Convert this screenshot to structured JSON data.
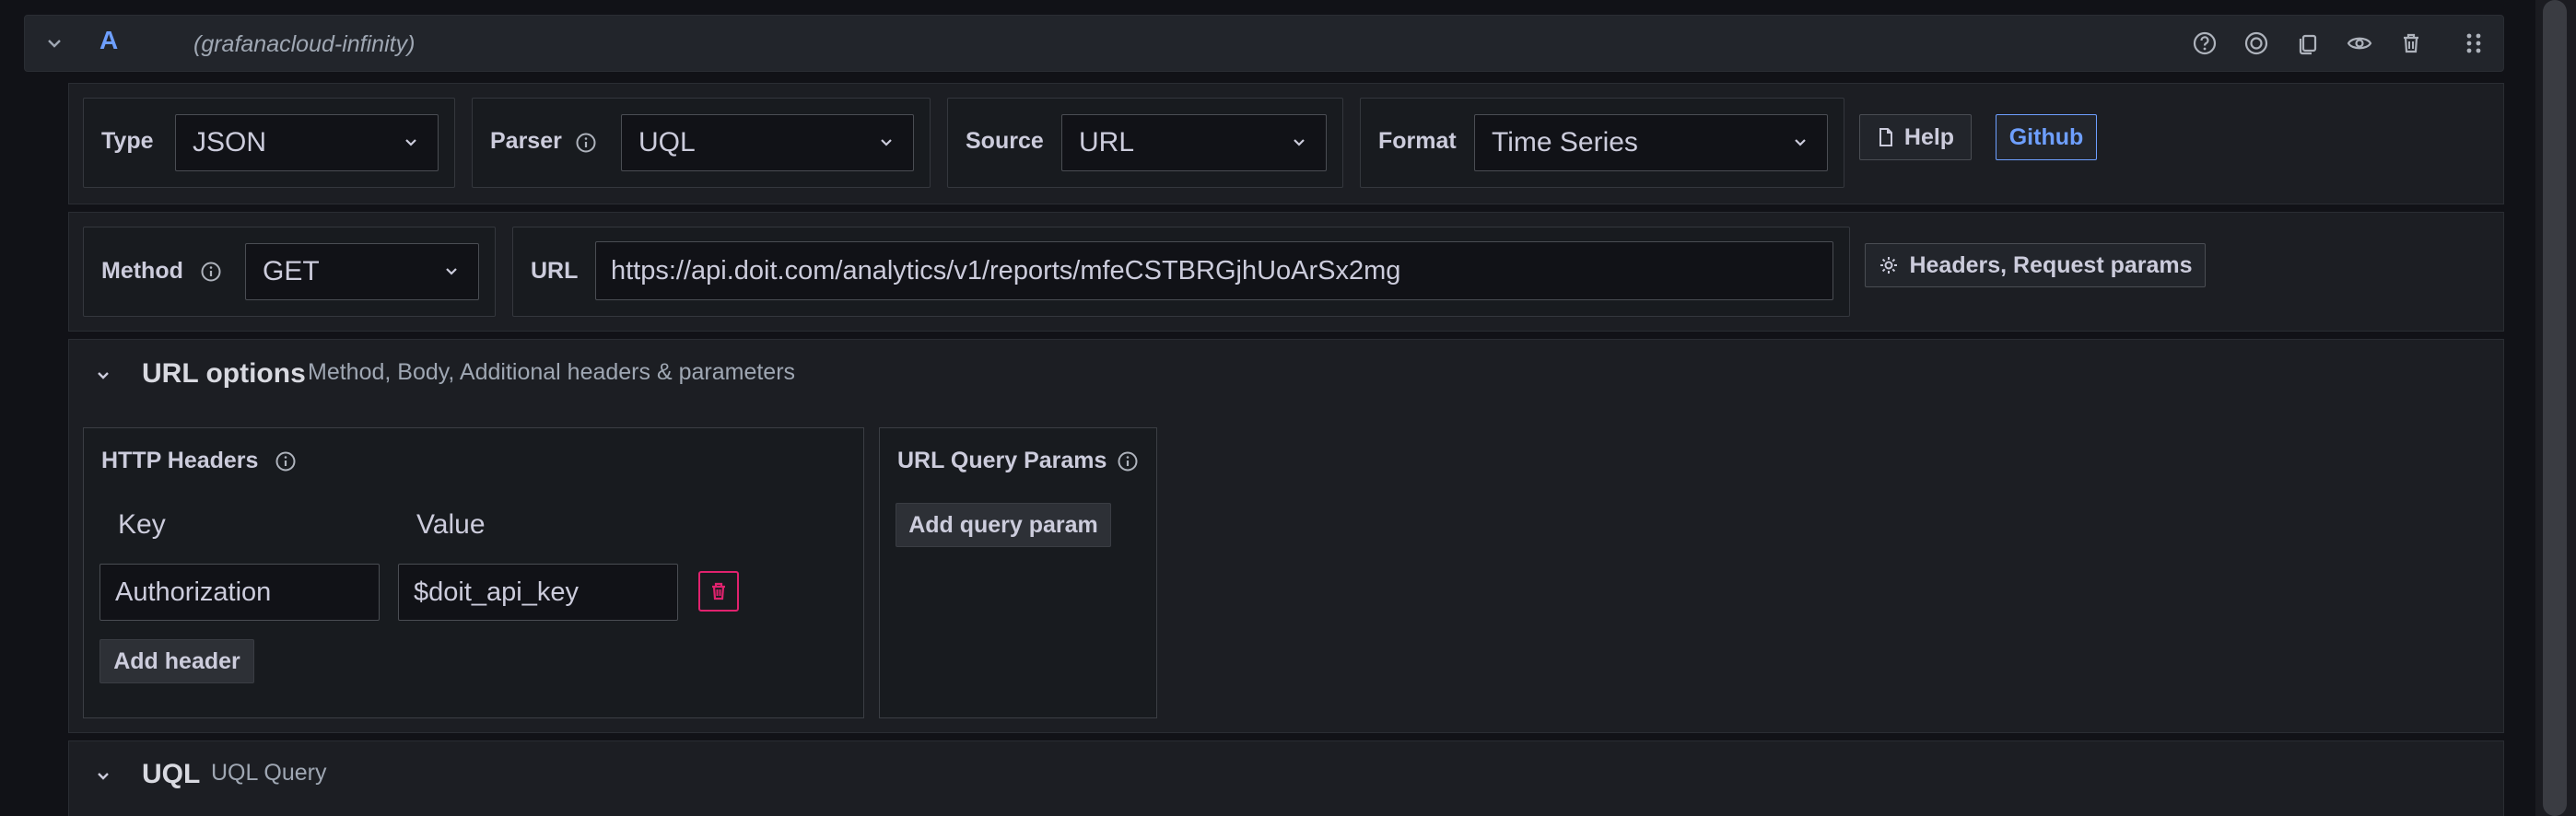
{
  "query": {
    "ref_id": "A",
    "datasource": "(grafanacloud-infinity)",
    "header_icons": [
      "help-circle-icon",
      "target-icon",
      "copy-icon",
      "eye-icon",
      "trash-icon",
      "drag-handle-icon"
    ]
  },
  "config_row": {
    "type_label": "Type",
    "type_value": "JSON",
    "parser_label": "Parser",
    "parser_value": "UQL",
    "source_label": "Source",
    "source_value": "URL",
    "format_label": "Format",
    "format_value": "Time Series",
    "help_label": "Help",
    "github_label": "Github"
  },
  "request_row": {
    "method_label": "Method",
    "method_value": "GET",
    "url_label": "URL",
    "url_value": "https://api.doit.com/analytics/v1/reports/mfeCSTBRGjhUoArSx2mg",
    "headers_button": "Headers, Request params"
  },
  "url_options": {
    "title": "URL options",
    "subtitle": "Method, Body, Additional headers & parameters",
    "http_headers": {
      "title": "HTTP Headers",
      "key_header": "Key",
      "value_header": "Value",
      "rows": [
        {
          "key": "Authorization",
          "value": "$doit_api_key"
        }
      ],
      "add_button": "Add header"
    },
    "query_params": {
      "title": "URL Query Params",
      "add_button": "Add query param"
    }
  },
  "uql": {
    "title": "UQL",
    "subtitle": "UQL Query"
  },
  "colors": {
    "accent_blue": "#6e9fff",
    "danger": "#e0226e",
    "background": "#111217",
    "panel": "#1c1e23"
  }
}
